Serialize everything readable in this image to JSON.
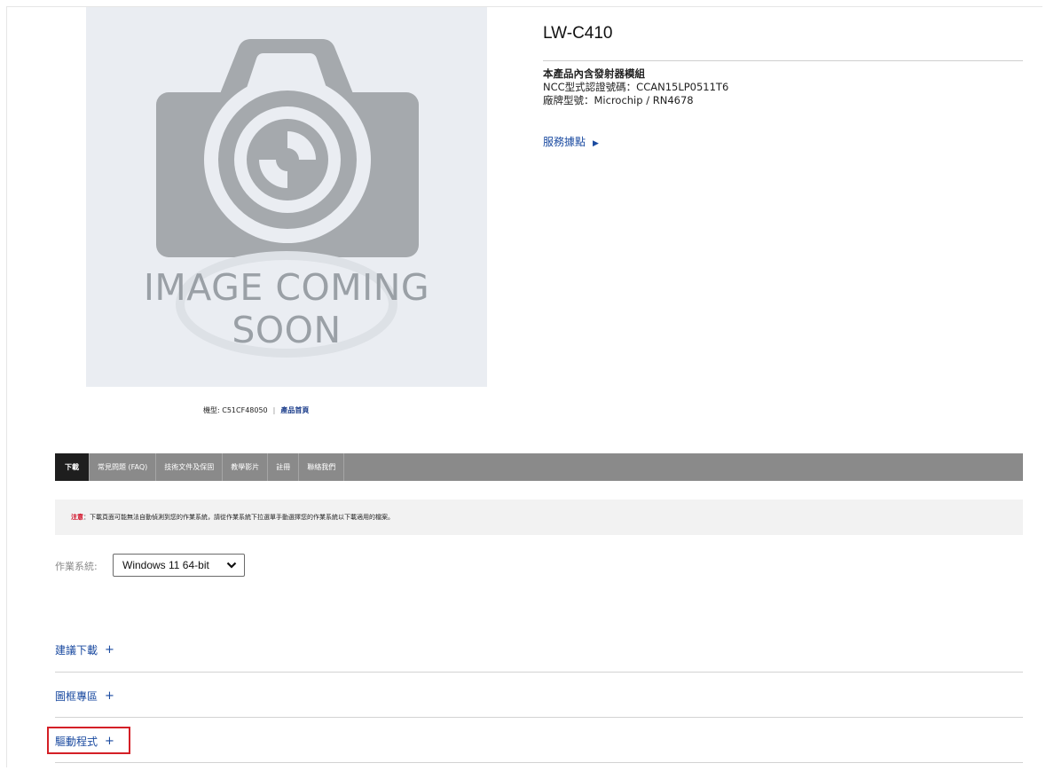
{
  "product": {
    "image_caption": "IMAGE COMING SOON",
    "model_label": "機型: C51CF48050",
    "model_separator": "|",
    "home_link": "產品首頁",
    "title": "LW-C410",
    "desc_line1": "本產品內含發射器模組",
    "desc_line2": "NCC型式認證號碼：CCAN15LP0511T6",
    "desc_line3": "廠牌型號：Microchip / RN4678",
    "service_link": "服務據點",
    "service_arrow": "▶"
  },
  "tabs": [
    {
      "label": "下載",
      "active": true
    },
    {
      "label": "常見問題 (FAQ)",
      "active": false
    },
    {
      "label": "技術文件及保固",
      "active": false
    },
    {
      "label": "教學影片",
      "active": false
    },
    {
      "label": "註冊",
      "active": false
    },
    {
      "label": "聯絡我們",
      "active": false
    }
  ],
  "notice": {
    "label": "注意",
    "text": "：下載頁面可能無法自動偵測到您的作業系統，請從作業系統下拉選單手動選擇您的作業系統以下載適用的檔案。"
  },
  "os_selector": {
    "label": "作業系統:",
    "selected": "Windows 11 64-bit"
  },
  "sections": [
    {
      "label": "建議下載",
      "icon": "+"
    },
    {
      "label": "圖框專區",
      "icon": "+"
    },
    {
      "label": "驅動程式",
      "icon": "+"
    }
  ],
  "colors": {
    "tab_bar": "#8a8a8a",
    "tab_active": "#1e1e1e",
    "link_blue": "#1a4aa0",
    "highlight_red": "#d41f26",
    "notice_label_red": "#d0021b"
  }
}
